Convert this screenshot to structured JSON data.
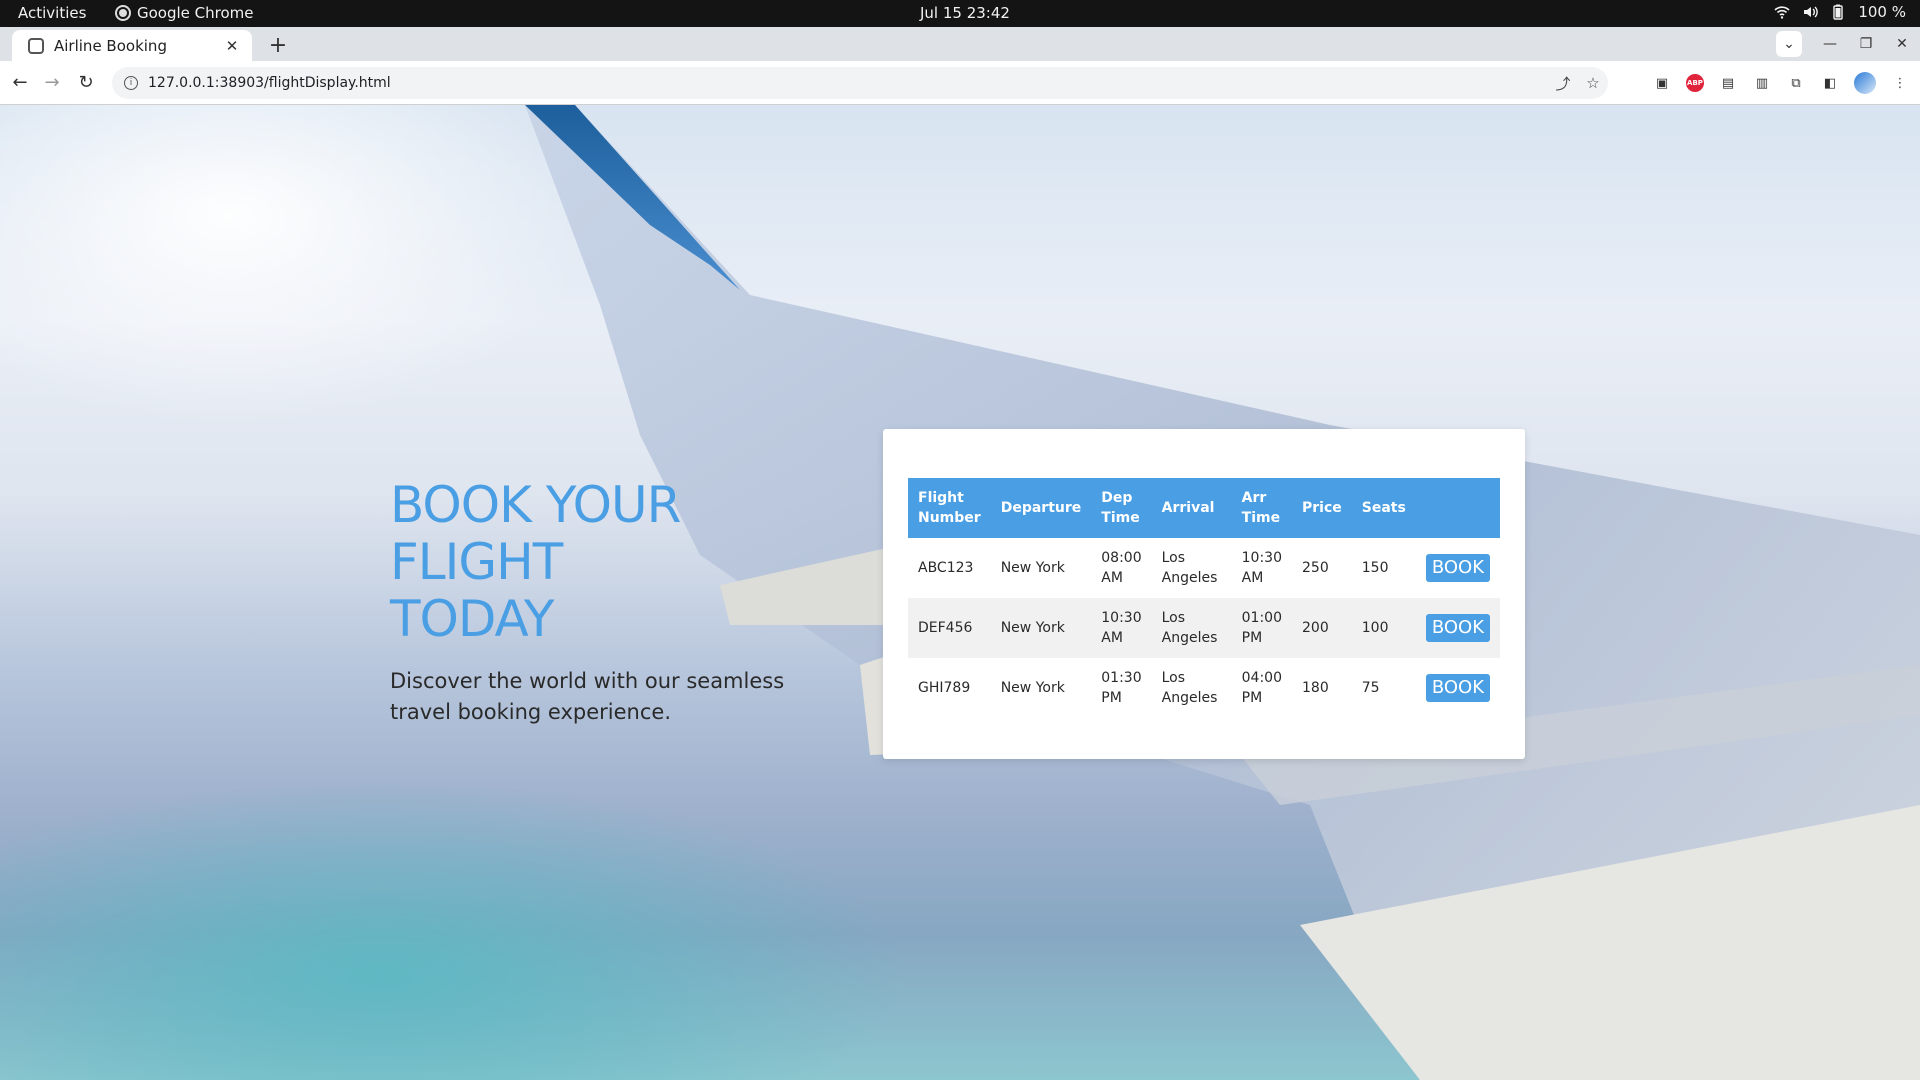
{
  "os_bar": {
    "activities": "Activities",
    "app_name": "Google Chrome",
    "clock": "Jul 15  23:42",
    "battery": "100 %"
  },
  "browser": {
    "tab_title": "Airline Booking",
    "url": "127.0.0.1:38903/flightDisplay.html"
  },
  "hero": {
    "title_line1": "BOOK YOUR",
    "title_line2": "FLIGHT",
    "title_line3": "TODAY",
    "subtitle": "Discover the world with our seamless travel booking experience."
  },
  "table": {
    "headers": {
      "flight_number": "Flight Number",
      "departure": "Departure",
      "dep_time": "Dep Time",
      "arrival": "Arrival",
      "arr_time": "Arr Time",
      "price": "Price",
      "seats": "Seats"
    },
    "rows": [
      {
        "flight": "ABC123",
        "departure": "New York",
        "dep_time": "08:00 AM",
        "arrival": "Los Angeles",
        "arr_time": "10:30 AM",
        "price": "250",
        "seats": "150",
        "action": "BOOK"
      },
      {
        "flight": "DEF456",
        "departure": "New York",
        "dep_time": "10:30 AM",
        "arrival": "Los Angeles",
        "arr_time": "01:00 PM",
        "price": "200",
        "seats": "100",
        "action": "BOOK"
      },
      {
        "flight": "GHI789",
        "departure": "New York",
        "dep_time": "01:30 PM",
        "arrival": "Los Angeles",
        "arr_time": "04:00 PM",
        "price": "180",
        "seats": "75",
        "action": "BOOK"
      }
    ]
  },
  "colors": {
    "accent": "#4a9ee3"
  }
}
